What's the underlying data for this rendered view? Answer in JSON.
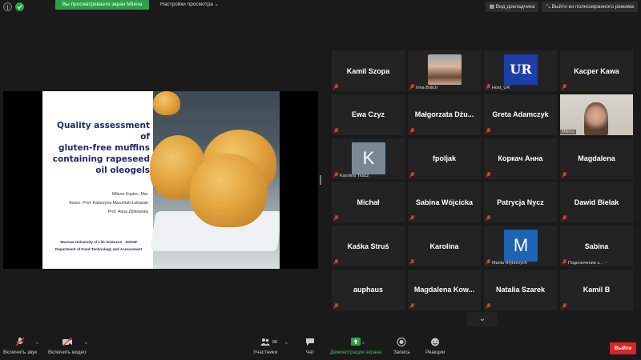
{
  "top": {
    "share_banner": "Вы просматриваете экран Milena",
    "view_options": "Настройки просмотра ⌄",
    "view_mode": "Вид докладчика",
    "exit_fullscreen": "Выйти из полноэкранного режима"
  },
  "slide": {
    "title_line1": "Quality assessment of",
    "title_line2": "gluten-free muffins",
    "title_line3": "containing rapeseed",
    "title_line4": "oil oleogels",
    "author1": "Milena Kupiec, Msc",
    "author2": "Assoc. Prof. Katarzyna Marciniak-Łukasiak",
    "author3": "Prof. Anna Żbikowska",
    "affil1": "Warsaw University of Life Sciences - SGGW",
    "affil2": "Department of Food Technology and Assessment"
  },
  "participants": [
    {
      "name": "Kamil Szopa",
      "label": ""
    },
    {
      "name": "",
      "label": "Irina Bolich"
    },
    {
      "name": "",
      "label": "Host_UR"
    },
    {
      "name": "Kacper Kawa",
      "label": ""
    },
    {
      "name": "Ewa Czyz",
      "label": ""
    },
    {
      "name": "Małgorzata  Dżu...",
      "label": ""
    },
    {
      "name": "Greta Adamczyk",
      "label": ""
    },
    {
      "name": "",
      "label": "Milena"
    },
    {
      "name": "",
      "label": "Karolina Tkacz",
      "letter": "K"
    },
    {
      "name": "fpoljak",
      "label": ""
    },
    {
      "name": "Коркач Анна",
      "label": ""
    },
    {
      "name": "Magdalena",
      "label": ""
    },
    {
      "name": "Michał",
      "label": ""
    },
    {
      "name": "Sabina Wójcicka",
      "label": ""
    },
    {
      "name": "Patrycja Nycz",
      "label": ""
    },
    {
      "name": "Dawid Bielak",
      "label": ""
    },
    {
      "name": "Kaśka Struś",
      "label": ""
    },
    {
      "name": "Karolina",
      "label": ""
    },
    {
      "name": "",
      "label": "Mariia Hrytsevych",
      "letter": "M"
    },
    {
      "name": "Sabina",
      "label": "Подключение з... ⋯"
    },
    {
      "name": "auphaus",
      "label": ""
    },
    {
      "name": "Magdalena  Kow...",
      "label": ""
    },
    {
      "name": "Natalia Szarek",
      "label": ""
    },
    {
      "name": "Kamil B",
      "label": ""
    }
  ],
  "toolbar": {
    "unmute": "Включить звук",
    "start_video": "Включить видео",
    "participants": "Участники",
    "participants_count": "88",
    "chat": "Чат",
    "share_screen": "Демонстрация экрана",
    "record": "Запись",
    "reactions": "Реакции",
    "leave": "Выйти"
  },
  "colors": {
    "accent_green": "#2da147",
    "leave_red": "#d92525",
    "active_speaker": "#c8d84a",
    "mute_red": "#e0443e"
  }
}
